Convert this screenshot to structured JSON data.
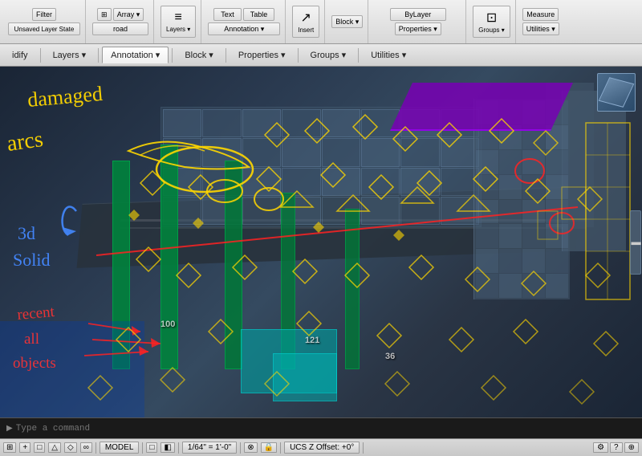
{
  "toolbar": {
    "groups": [
      {
        "id": "filter",
        "buttons": [
          "Filter",
          "Unsaved Layer State"
        ]
      },
      {
        "id": "array",
        "label": "Array ▾",
        "sublabel": "road"
      },
      {
        "id": "layers",
        "label": "Layers ▾"
      },
      {
        "id": "text",
        "label": "Text"
      },
      {
        "id": "table",
        "label": "Table"
      },
      {
        "id": "annotation",
        "label": "Annotation ▾"
      },
      {
        "id": "insert",
        "label": "Insert"
      },
      {
        "id": "block",
        "label": "Block ▾"
      },
      {
        "id": "properties",
        "label": "Properties ▾"
      },
      {
        "id": "bylayer",
        "label": "ByLayer"
      },
      {
        "id": "groups",
        "label": "Groups ▾"
      },
      {
        "id": "utilities",
        "label": "Utilities ▾"
      }
    ]
  },
  "ribbon": {
    "tabs": [
      {
        "id": "modify",
        "label": "Modify"
      },
      {
        "id": "layers",
        "label": "Layers"
      },
      {
        "id": "annotation",
        "label": "Annotation"
      },
      {
        "id": "block",
        "label": "Block"
      },
      {
        "id": "properties",
        "label": "Properties"
      },
      {
        "id": "groups",
        "label": "Groups"
      },
      {
        "id": "utilities",
        "label": "Utilities"
      }
    ]
  },
  "canvas": {
    "annotations": {
      "handwritten_text": [
        "damaged",
        "arcs",
        "3d",
        "Solid",
        "recent",
        "all",
        "objects"
      ],
      "arrows": [
        "blue_curved_arrow",
        "red_diagonal_line",
        "red_arrows_group"
      ]
    }
  },
  "command_line": {
    "placeholder": "Type a command"
  },
  "status_bar": {
    "model_label": "MODEL",
    "scale_label": "1/64\" = 1'-0\"",
    "ucs_label": "UCS Z Offset: +0°",
    "buttons": [
      "MODEL",
      "1/64\" = 1'-0\"",
      "UCS Z Offset: +0\""
    ]
  },
  "nav_cube": {
    "label": "NavCube"
  },
  "icons": {
    "array_icon": "⊞",
    "road_icon": "≡",
    "text_icon": "A",
    "table_icon": "▦",
    "insert_icon": "↗",
    "group_icon": "⊡",
    "measure_icon": "📏",
    "layers_icon": "≡",
    "chevron": "▾",
    "model_icon": "□",
    "lock_icon": "🔒",
    "settings_icon": "⚙"
  }
}
